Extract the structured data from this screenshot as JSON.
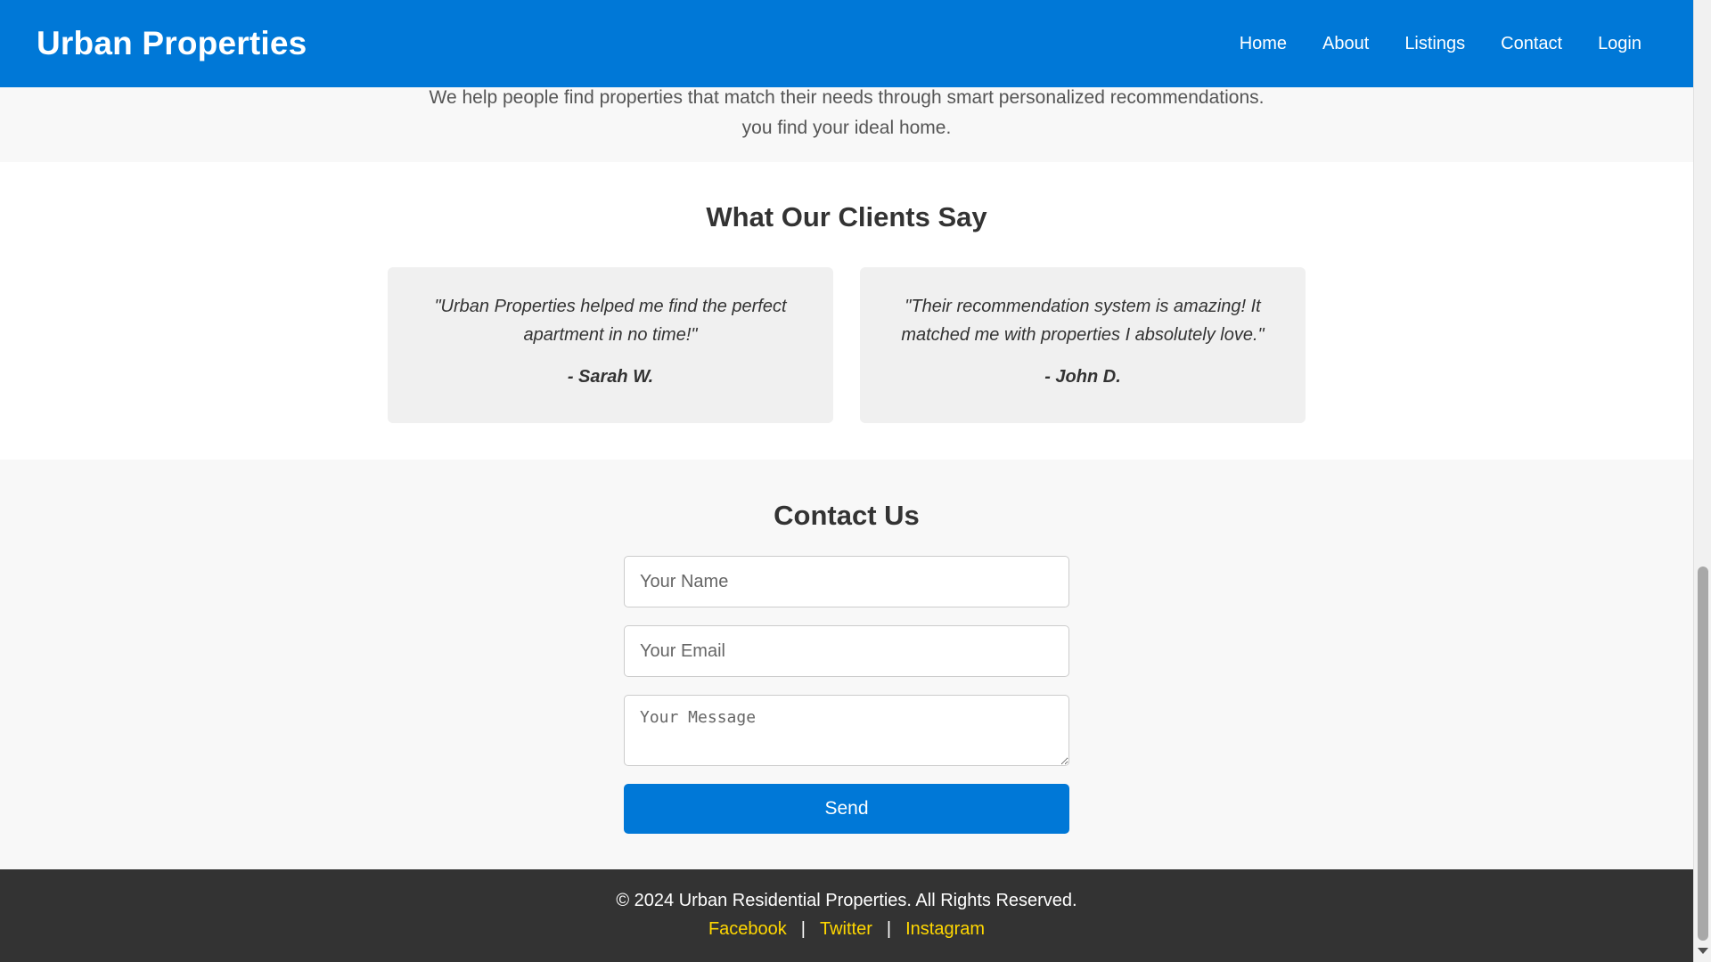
{
  "header": {
    "logo": "Urban Properties",
    "nav": [
      "Home",
      "About",
      "Listings",
      "Contact",
      "Login"
    ]
  },
  "about": {
    "partial_line": "We help people find properties that match their needs through smart personalized recommendations.",
    "last_line": "you find your ideal home."
  },
  "testimonials": {
    "title": "What Our Clients Say",
    "items": [
      {
        "quote": "\"Urban Properties helped me find the perfect apartment in no time!\"",
        "author": "- Sarah W."
      },
      {
        "quote": "\"Their recommendation system is amazing! It matched me with properties I absolutely love.\"",
        "author": "- John D."
      }
    ]
  },
  "contact": {
    "title": "Contact Us",
    "name_placeholder": "Your Name",
    "email_placeholder": "Your Email",
    "message_placeholder": "Your Message",
    "send_label": "Send"
  },
  "footer": {
    "copyright": "© 2024 Urban Residential Properties. All Rights Reserved.",
    "social": [
      "Facebook",
      "Twitter",
      "Instagram"
    ],
    "separator": "|"
  },
  "colors": {
    "primary": "#0078d7",
    "footer_bg": "#333333",
    "social_link": "#ffd700",
    "card_bg": "#f0f0f0"
  }
}
